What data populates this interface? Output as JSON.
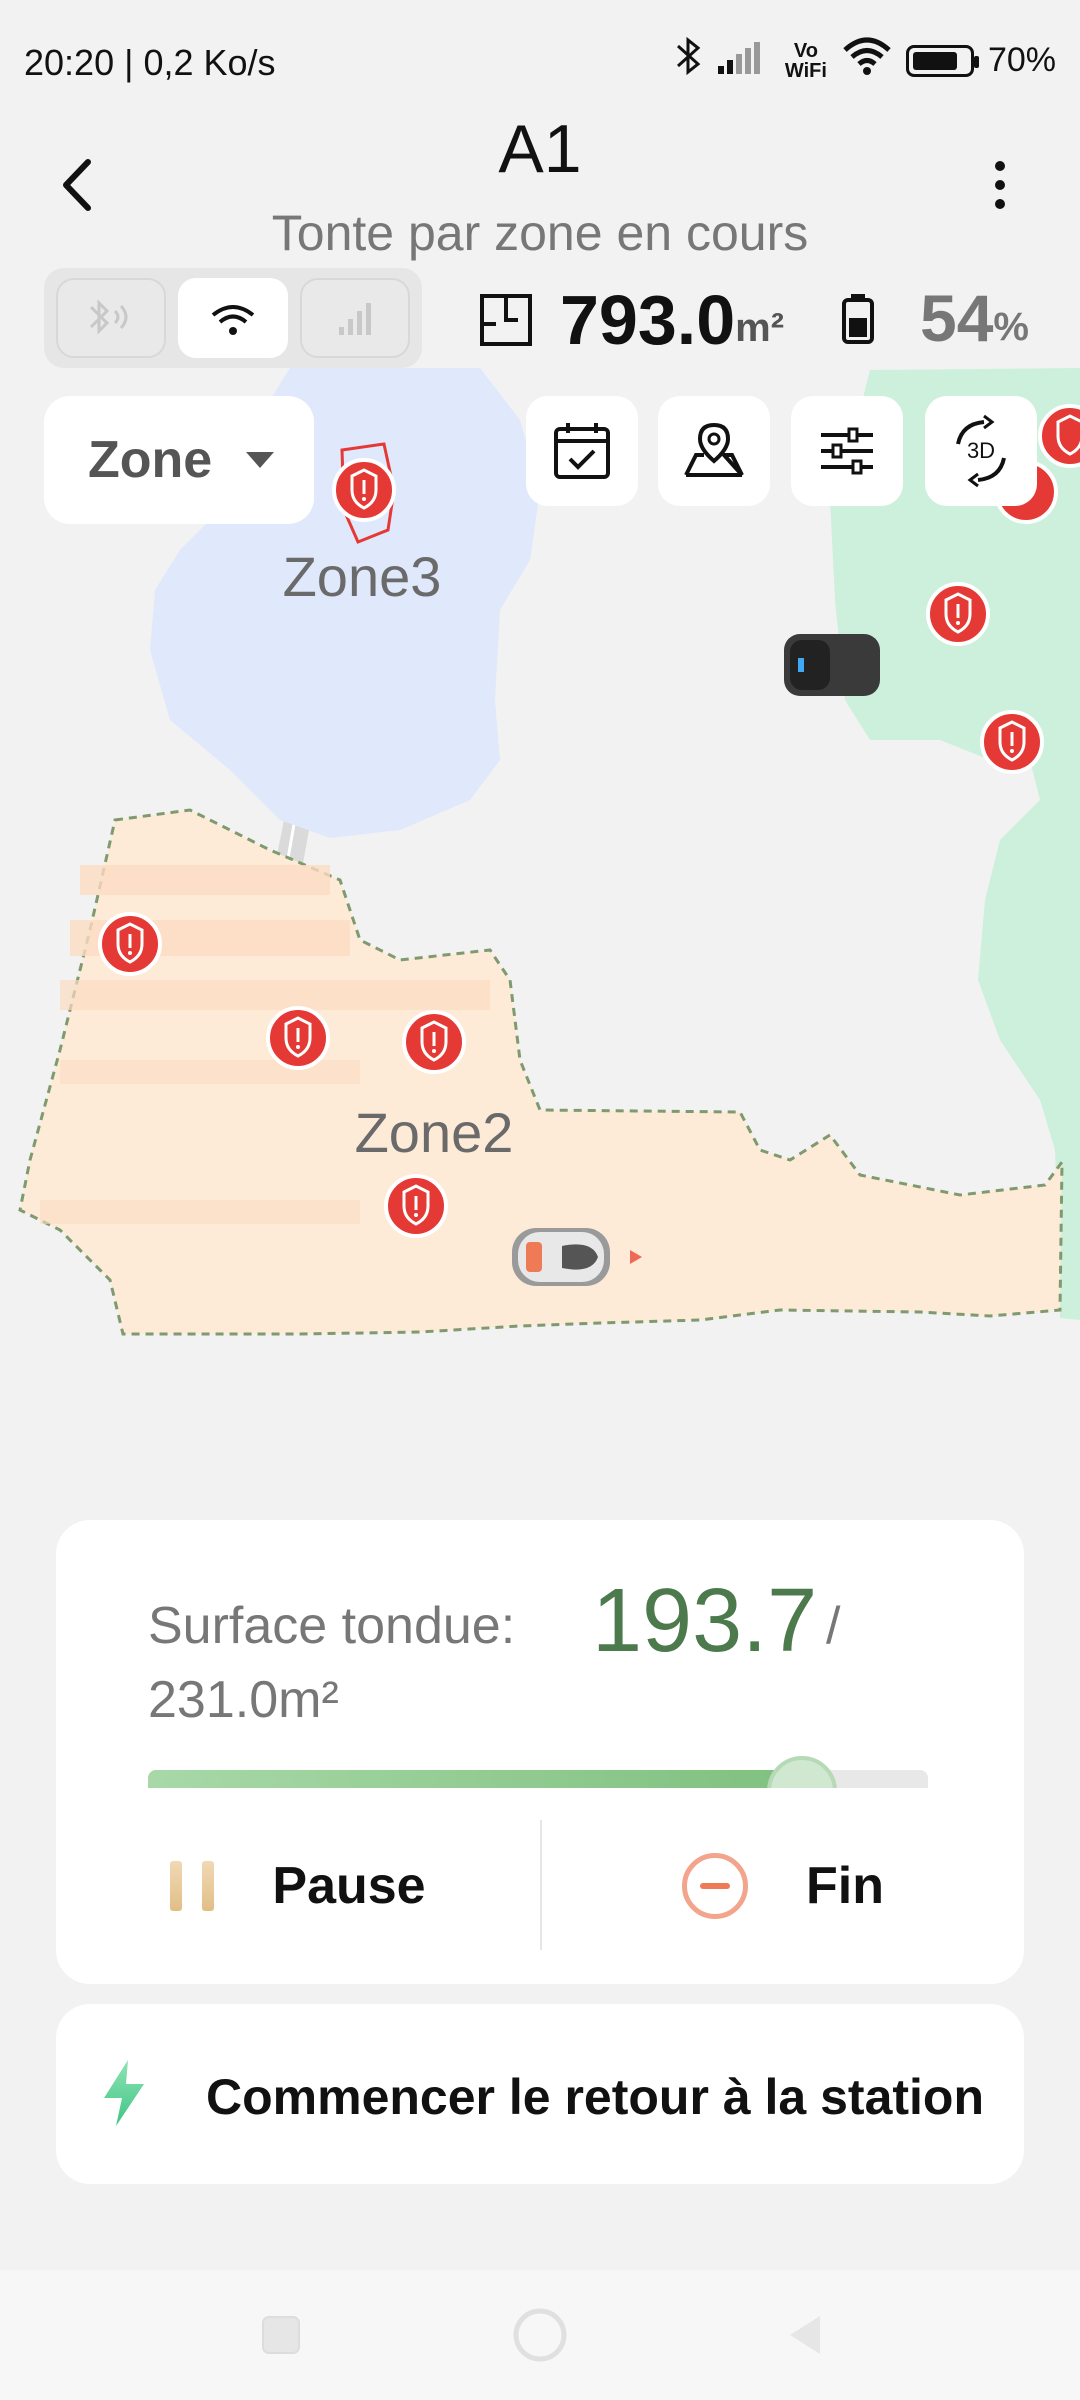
{
  "status_bar": {
    "time_speed": "20:20 | 0,2 Ko/s",
    "vowifi": "Vo WiFi",
    "battery": "70%"
  },
  "header": {
    "title": "A1",
    "subtitle": "Tonte par zone en cours"
  },
  "stats": {
    "area_value": "793.0",
    "area_unit": "m²",
    "battery_value": "54",
    "battery_unit": "%"
  },
  "map": {
    "zone_dropdown_label": "Zone",
    "zones": [
      "Zone3",
      "Zone2"
    ],
    "colors": {
      "zone3_fill": "#e0e8fb",
      "zone2_fill": "#fdebd8",
      "green_area": "#cdf0dc",
      "marker": "#e53935"
    }
  },
  "progress": {
    "label": "Surface tondue:",
    "mowed": "193.7",
    "slash": "/",
    "total": "231.0m²",
    "fraction": 0.8385
  },
  "actions": {
    "pause_label": "Pause",
    "end_label": "Fin",
    "return_label": "Commencer le retour à la station"
  }
}
